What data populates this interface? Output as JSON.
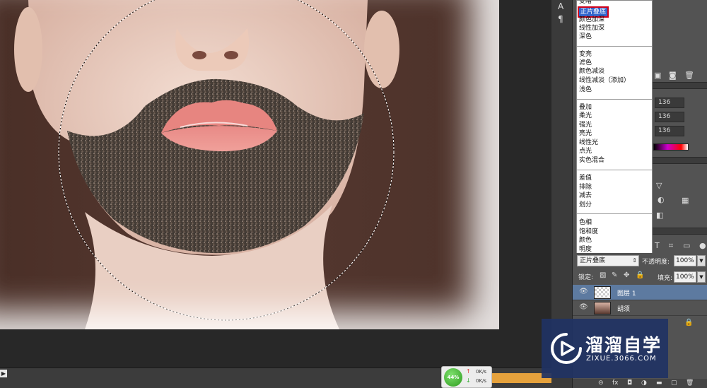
{
  "blend_menu": {
    "items": [
      {
        "label": "变暗"
      },
      {
        "label": "正片叠底",
        "selected": true
      },
      {
        "label": "颜色加深"
      },
      {
        "label": "线性加深"
      },
      {
        "label": "深色"
      },
      {
        "label": "变亮"
      },
      {
        "label": "滤色"
      },
      {
        "label": "颜色减淡"
      },
      {
        "label": "线性减淡（添加）"
      },
      {
        "label": "浅色"
      },
      {
        "label": "叠加"
      },
      {
        "label": "柔光"
      },
      {
        "label": "强光"
      },
      {
        "label": "亮光"
      },
      {
        "label": "线性光"
      },
      {
        "label": "点光"
      },
      {
        "label": "实色混合"
      },
      {
        "label": "差值"
      },
      {
        "label": "排除"
      },
      {
        "label": "减去"
      },
      {
        "label": "划分"
      },
      {
        "label": "色相"
      },
      {
        "label": "饱和度"
      },
      {
        "label": "颜色"
      },
      {
        "label": "明度"
      }
    ]
  },
  "color_panel": {
    "r": "136",
    "g": "136",
    "b": "136"
  },
  "layers_panel": {
    "blend_mode": "正片叠底",
    "opacity_label": "不透明度:",
    "opacity_value": "100%",
    "lock_label": "锁定:",
    "fill_label": "填充:",
    "fill_value": "100%",
    "layers": [
      {
        "name": "图层 1",
        "active": true
      },
      {
        "name": "胡须",
        "active": false
      }
    ]
  },
  "network_meter": {
    "percent": "44%",
    "up": "0K/s",
    "down": "0K/s"
  },
  "watermark": {
    "title": "溜溜自学",
    "url": "ZIXUE.3066.COM"
  },
  "colors": {
    "accent_selected": "#3366cc",
    "highlight_border": "#d0021b",
    "watermark_bg": "#203363"
  }
}
